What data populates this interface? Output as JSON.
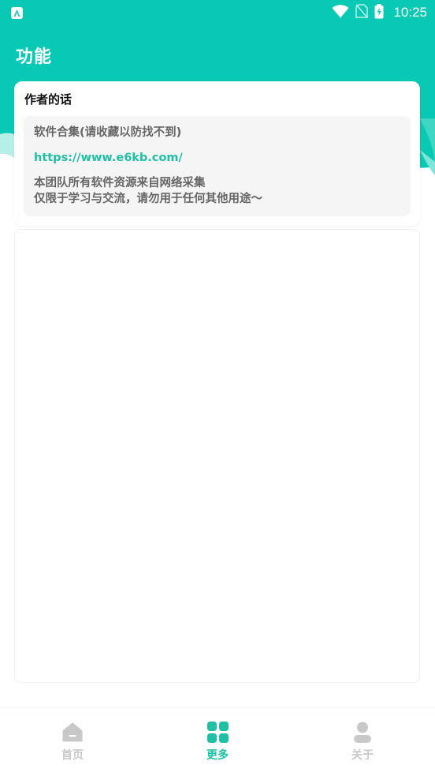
{
  "colors": {
    "accent": "#1fc0a6",
    "header_bg": "#08c9b4",
    "inactive": "#c8c8c8",
    "card_inner_bg": "#f5f5f5"
  },
  "status_bar": {
    "time": "10:25",
    "icons": [
      "app-notification-icon",
      "wifi-icon",
      "no-sim-icon",
      "battery-charging-icon"
    ]
  },
  "app_bar": {
    "title": "功能"
  },
  "author_card": {
    "title": "作者的话",
    "heading": "软件合集(请收藏以防找不到)",
    "link": "https://www.e6kb.com/",
    "desc_line1": "本团队所有软件资源来自网络采集",
    "desc_line2": "仅限于学习与交流，请勿用于任何其他用途～"
  },
  "bottom_nav": {
    "items": [
      {
        "label": "首页",
        "icon": "home-icon",
        "active": false
      },
      {
        "label": "更多",
        "icon": "grid-icon",
        "active": true
      },
      {
        "label": "关于",
        "icon": "person-icon",
        "active": false
      }
    ]
  }
}
